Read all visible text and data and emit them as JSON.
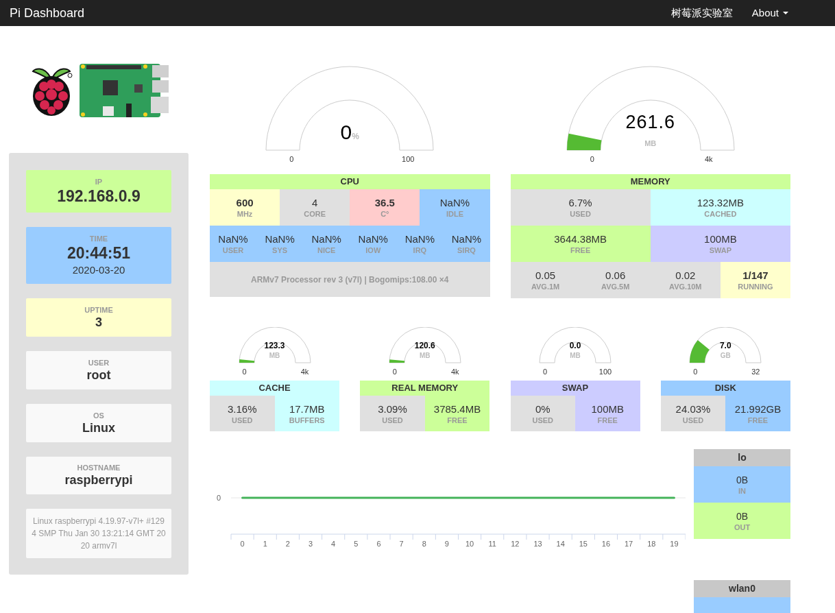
{
  "navbar": {
    "brand": "Pi Dashboard",
    "links": [
      {
        "label": "树莓派实验室",
        "kind": "link"
      },
      {
        "label": "About",
        "kind": "dropdown"
      }
    ]
  },
  "sidebar": {
    "primary_cards": [
      {
        "label": "IP",
        "value": "192.168.0.9",
        "color": "#ccff99"
      },
      {
        "label": "TIME",
        "value": "20:44:51",
        "sub": "2020-03-20",
        "color": "#99ccff"
      }
    ],
    "cards": [
      {
        "label": "UPTIME",
        "value": "3",
        "color": "#ffffcc"
      },
      {
        "label": "USER",
        "value": "root",
        "color": "#f9f9f9"
      },
      {
        "label": "OS",
        "value": "Linux",
        "color": "#f9f9f9"
      },
      {
        "label": "HOSTNAME",
        "value": "raspberrypi",
        "color": "#f9f9f9"
      }
    ],
    "uname": "Linux raspberrypi 4.19.97-v7l+ #1294 SMP Thu Jan 30 13:21:14 GMT 2020 armv7l"
  },
  "panels": [
    {
      "gauge": {
        "value": "0",
        "suffix": "%",
        "min": "0",
        "max": "100"
      },
      "title": "CPU",
      "rows": [
        {
          "kind": "stats",
          "cells": [
            {
              "value": "600",
              "label": "MHz",
              "color": "#ffffcc",
              "bold": true
            },
            {
              "value": "4",
              "label": "CORE",
              "color": "#e0e0e0",
              "bold": false
            },
            {
              "value": "36.5",
              "label": "C°",
              "color": "#ffcccc",
              "bold": true
            },
            {
              "value": "NaN%",
              "label": "IDLE",
              "color": "#99ccff",
              "bold": false
            }
          ]
        },
        {
          "kind": "stats",
          "cells": [
            {
              "value": "NaN%",
              "label": "USER",
              "color": "#99ccff",
              "bold": false
            },
            {
              "value": "NaN%",
              "label": "SYS",
              "color": "#99ccff",
              "bold": false
            },
            {
              "value": "NaN%",
              "label": "NICE",
              "color": "#99ccff",
              "bold": false
            },
            {
              "value": "NaN%",
              "label": "IOW",
              "color": "#99ccff",
              "bold": false
            },
            {
              "value": "NaN%",
              "label": "IRQ",
              "color": "#99ccff",
              "bold": false
            },
            {
              "value": "NaN%",
              "label": "SIRQ",
              "color": "#99ccff",
              "bold": false
            }
          ]
        },
        {
          "kind": "note",
          "text": "ARMv7 Processor rev 3 (v7l) | Bogomips:108.00 ×4",
          "color": "#e0e0e0"
        }
      ]
    },
    {
      "gauge": {
        "value": "261.6",
        "unit": "MB",
        "min": "0",
        "max": "4k"
      },
      "title": "MEMORY",
      "rows": [
        {
          "kind": "stats",
          "cells": [
            {
              "value": "6.7%",
              "label": "USED",
              "color": "#e0e0e0",
              "bold": false
            },
            {
              "value": "123.32MB",
              "label": "CACHED",
              "color": "#ccffff",
              "bold": false
            }
          ]
        },
        {
          "kind": "stats",
          "cells": [
            {
              "value": "3644.38MB",
              "label": "FREE",
              "color": "#ccff99",
              "bold": false
            },
            {
              "value": "100MB",
              "label": "SWAP",
              "color": "#ccccff",
              "bold": false
            }
          ]
        },
        {
          "kind": "stats",
          "cells": [
            {
              "value": "0.05",
              "label": "AVG.1M",
              "color": "#e0e0e0",
              "bold": false
            },
            {
              "value": "0.06",
              "label": "AVG.5M",
              "color": "#e0e0e0",
              "bold": false
            },
            {
              "value": "0.02",
              "label": "AVG.10M",
              "color": "#e0e0e0",
              "bold": false
            },
            {
              "value": "1/147",
              "label": "RUNNING",
              "color": "#ffffcc",
              "bold": true
            }
          ]
        }
      ]
    }
  ],
  "small_panels": [
    {
      "gauge": {
        "value": "123.3",
        "unit": "MB",
        "min": "0",
        "max": "4k"
      },
      "title": "CACHE",
      "color": "#ccffff",
      "cells": [
        {
          "value": "3.16%",
          "label": "USED",
          "color": "#e0e0e0"
        },
        {
          "value": "17.7MB",
          "label": "BUFFERS",
          "color": "#ccffff"
        }
      ]
    },
    {
      "gauge": {
        "value": "120.6",
        "unit": "MB",
        "min": "0",
        "max": "4k"
      },
      "title": "REAL MEMORY",
      "color": "#ccff99",
      "cells": [
        {
          "value": "3.09%",
          "label": "USED",
          "color": "#e0e0e0"
        },
        {
          "value": "3785.4MB",
          "label": "FREE",
          "color": "#ccff99"
        }
      ]
    },
    {
      "gauge": {
        "value": "0.0",
        "unit": "MB",
        "min": "0",
        "max": "100"
      },
      "title": "SWAP",
      "color": "#ccccff",
      "cells": [
        {
          "value": "0%",
          "label": "USED",
          "color": "#e0e0e0"
        },
        {
          "value": "100MB",
          "label": "FREE",
          "color": "#ccccff"
        }
      ]
    },
    {
      "gauge": {
        "value": "7.0",
        "unit": "GB",
        "min": "0",
        "max": "32"
      },
      "title": "DISK",
      "color": "#99ccff",
      "cells": [
        {
          "value": "24.03%",
          "label": "USED",
          "color": "#e0e0e0"
        },
        {
          "value": "21.992GB",
          "label": "FREE",
          "color": "#99ccff"
        }
      ]
    }
  ],
  "network": {
    "traffic_chart": {
      "y_axis_label": "0",
      "x_axis_labels": [
        "0",
        "1",
        "2",
        "3",
        "4",
        "5",
        "6",
        "7",
        "8",
        "9",
        "10",
        "11",
        "12",
        "13",
        "14",
        "15",
        "16",
        "17",
        "18",
        "19"
      ]
    },
    "interfaces": [
      {
        "name": "lo",
        "in": "0B",
        "in_label": "IN",
        "out": "0B",
        "out_label": "OUT"
      },
      {
        "name": "wlan0"
      }
    ]
  }
}
